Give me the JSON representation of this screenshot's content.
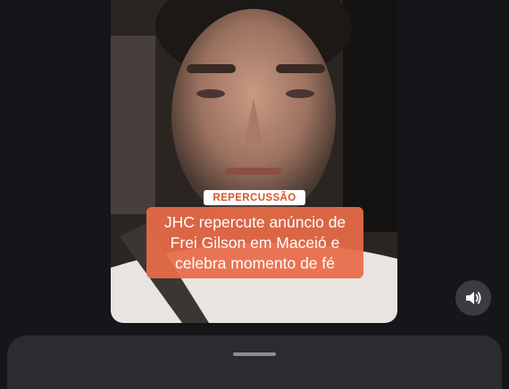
{
  "video": {
    "tag_label": "REPERCUSSÃO",
    "headline_lines": [
      "JHC repercute anúncio de",
      "Frei Gilson em Maceió e",
      "celebra momento de fé"
    ]
  },
  "controls": {
    "sound_icon": "speaker-volume-icon"
  },
  "colors": {
    "headline_bg": "#e86c48",
    "tag_text": "#d5562f",
    "page_bg": "#14161a"
  }
}
